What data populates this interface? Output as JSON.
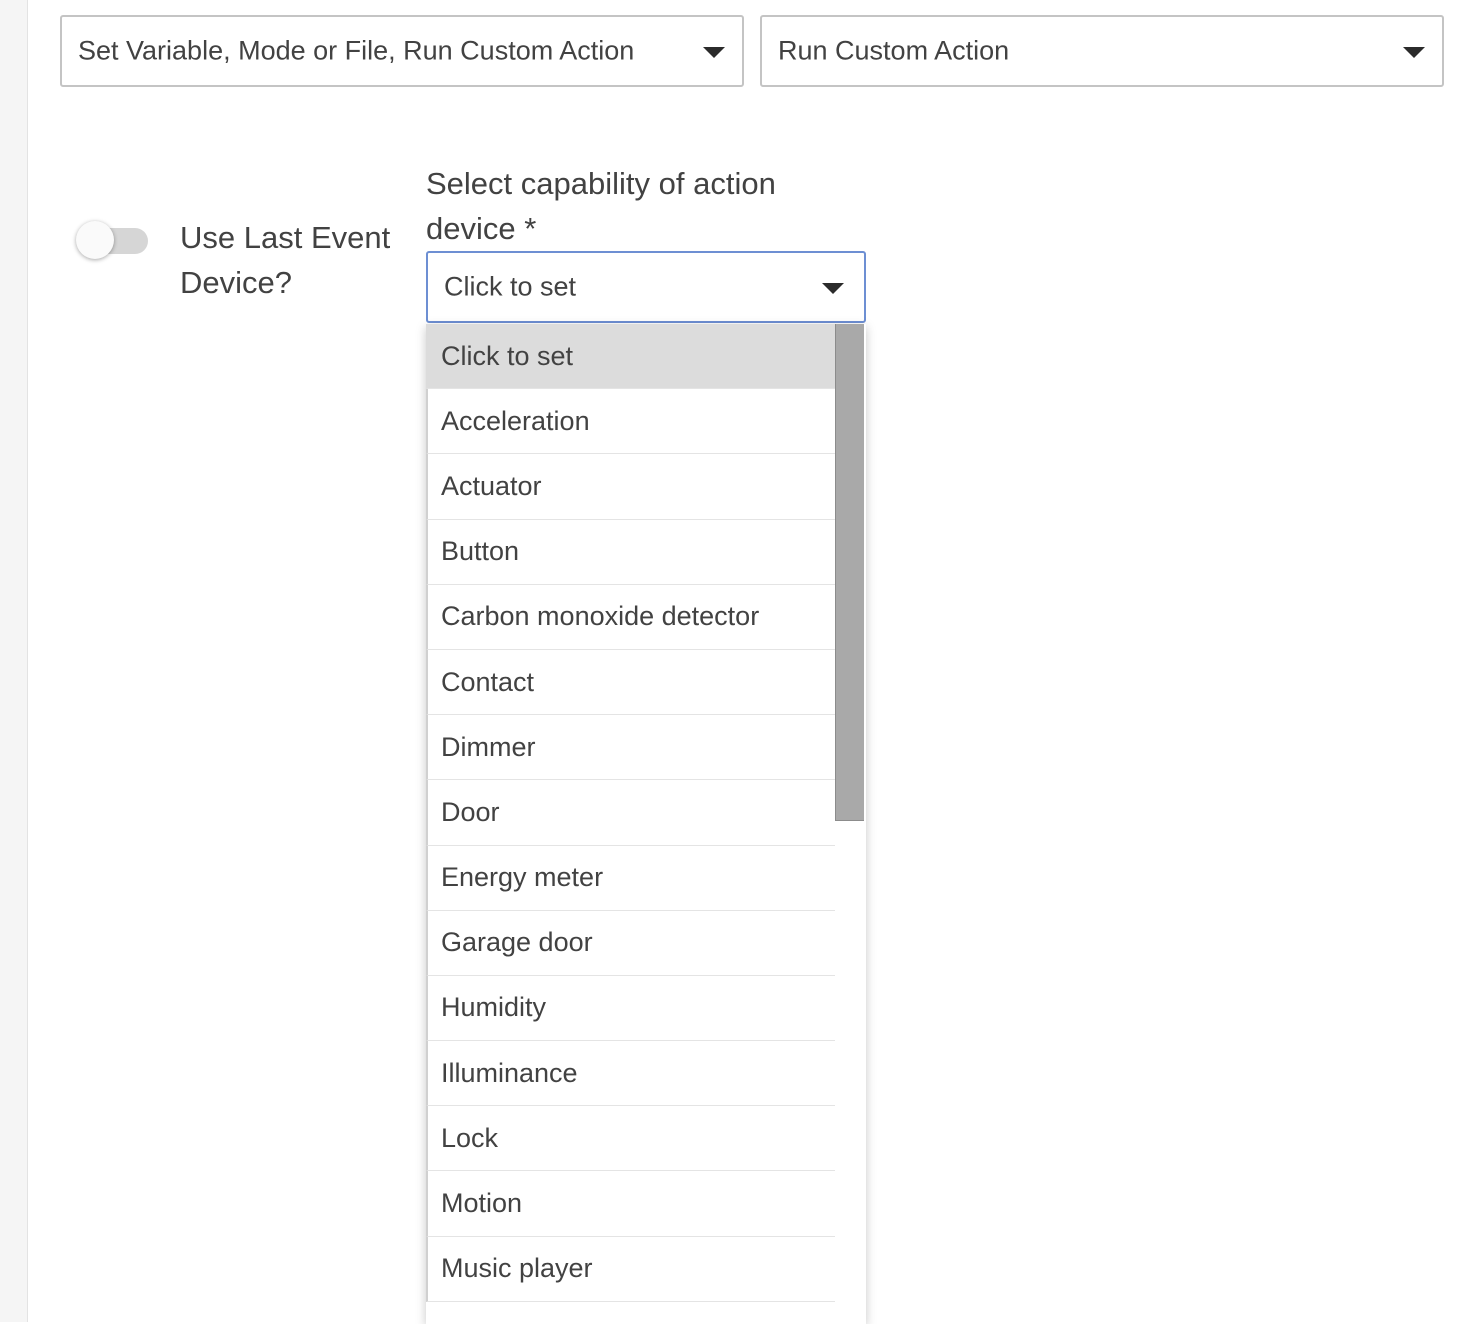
{
  "action_type_select": {
    "value": "Set Variable, Mode or File, Run Custom Action"
  },
  "action_sub_select": {
    "value": "Run Custom Action"
  },
  "use_last_event_device": {
    "label": "Use Last Event Device?",
    "checked": false
  },
  "capability": {
    "label": "Select capability of action device *",
    "value": "Click to set",
    "options": [
      "Click to set",
      "Acceleration",
      "Actuator",
      "Button",
      "Carbon monoxide detector",
      "Contact",
      "Dimmer",
      "Door",
      "Energy meter",
      "Garage door",
      "Humidity",
      "Illuminance",
      "Lock",
      "Motion",
      "Music player"
    ],
    "selected_option": "Click to set"
  },
  "icons": {
    "dropdown_caret": "chevron-down-icon"
  }
}
